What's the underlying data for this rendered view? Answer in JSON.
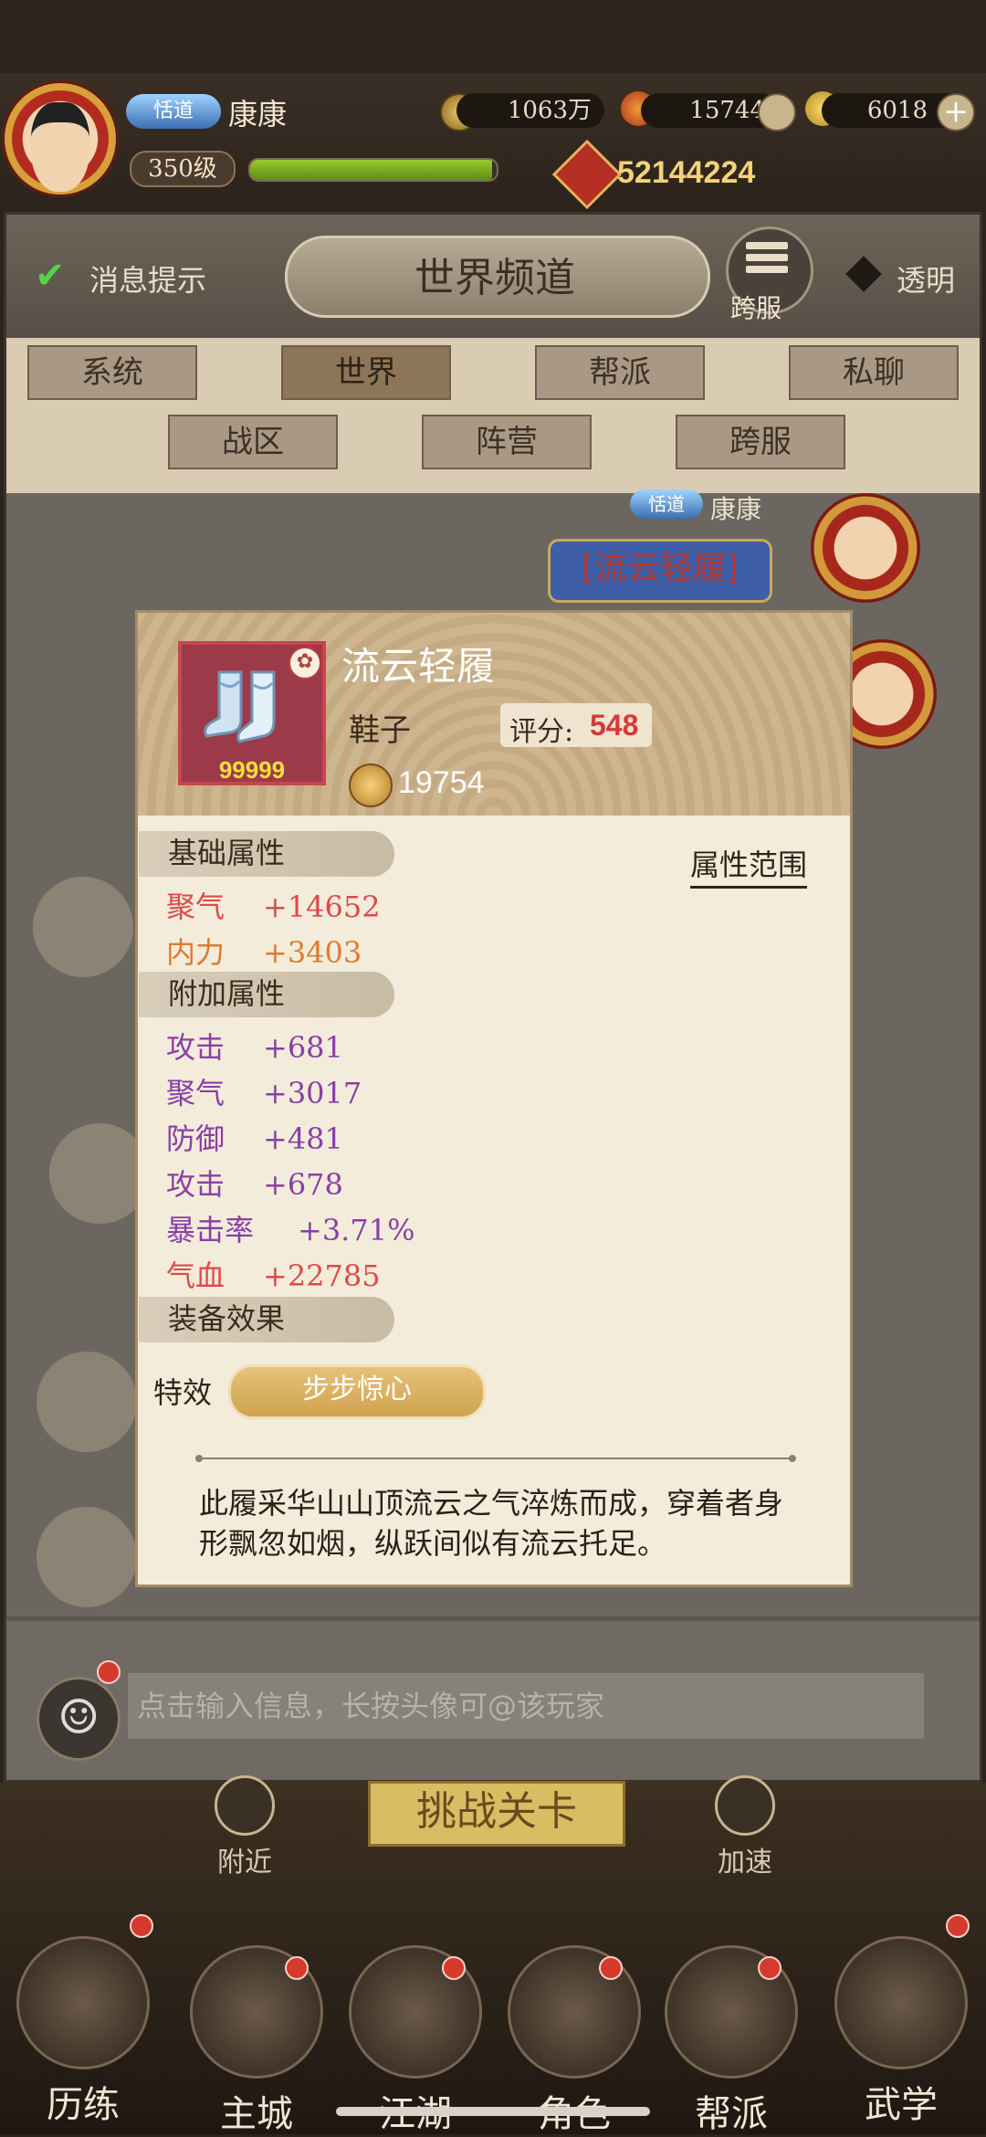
{
  "player": {
    "rank_badge": "恬道",
    "name": "康康",
    "level": "350级",
    "exp_fraction": 0.98,
    "power": "52144224"
  },
  "resources": [
    {
      "icon": "copper-coin-icon",
      "value": "1063万"
    },
    {
      "icon": "maple-leaf-icon",
      "value": "15744"
    },
    {
      "icon": "gold-ingot-icon",
      "value": "6018"
    }
  ],
  "chat": {
    "notify_label": "消息提示",
    "title": "世界频道",
    "cross_server_label": "跨服",
    "transparent_label": "透明",
    "tabs": [
      "系统",
      "世界",
      "帮派",
      "私聊",
      "战区",
      "阵营",
      "跨服"
    ],
    "active_tab": "世界",
    "message": {
      "rank_badge": "恬道",
      "name": "康康",
      "item_link": "[流云轻履]"
    },
    "input_placeholder": "点击输入信息，长按头像可@该玩家"
  },
  "item": {
    "name": "流云轻履",
    "type": "鞋子",
    "score_label": "评分:",
    "score": "548",
    "count": "99999",
    "power": "19754",
    "base_header": "基础属性",
    "range_link": "属性范围",
    "base_attrs": [
      {
        "name": "聚气",
        "value": "+14652",
        "color": "#e04848"
      },
      {
        "name": "内力",
        "value": "+3403",
        "color": "#e07a2e"
      }
    ],
    "extra_header": "附加属性",
    "extra_attrs": [
      {
        "name": "攻击",
        "value": "+681",
        "color": "#8a3fa8"
      },
      {
        "name": "聚气",
        "value": "+3017",
        "color": "#8a3fa8"
      },
      {
        "name": "防御",
        "value": "+481",
        "color": "#8a3fa8"
      },
      {
        "name": "攻击",
        "value": "+678",
        "color": "#8a3fa8"
      },
      {
        "name": "暴击率",
        "value": "+3.71%",
        "color": "#8a3fa8"
      },
      {
        "name": "气血",
        "value": "+22785",
        "color": "#e04848"
      }
    ],
    "effect_header": "装备效果",
    "special_label": "特效",
    "special_value": "步步惊心",
    "description": "此履采华山山顶流云之气淬炼而成，穿着者身形飘忽如烟，纵跃间似有流云托足。"
  },
  "bottom": {
    "challenge_button": "挑战关卡",
    "nearby_label": "附近",
    "speedup_label": "加速",
    "nav": [
      "历练",
      "主城",
      "江湖",
      "角色",
      "帮派",
      "武学"
    ]
  }
}
